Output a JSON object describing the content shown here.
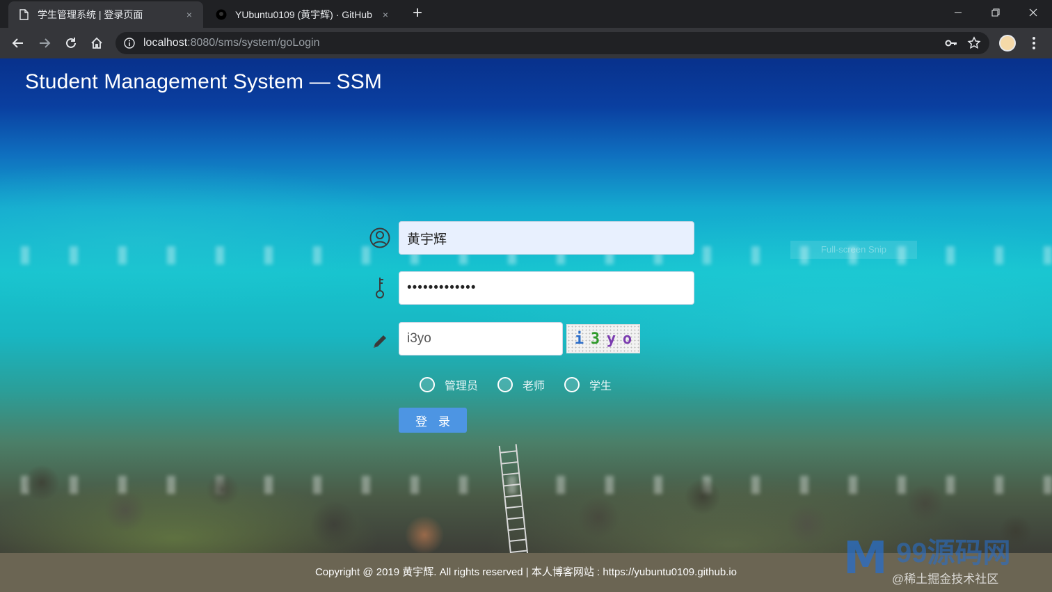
{
  "browser": {
    "tabs": [
      {
        "title": "学生管理系统 | 登录页面",
        "close": "×"
      },
      {
        "title": "YUbuntu0109 (黄宇辉) · GitHub",
        "close": "×"
      }
    ],
    "new_tab": "+",
    "url_host": "localhost",
    "url_path": ":8080/sms/system/goLogin"
  },
  "page": {
    "title": "Student Management System — SSM",
    "username_value": "黄宇辉",
    "password_value": "•••••••••••••",
    "captcha_input_value": "i3yo",
    "captcha_chars": [
      {
        "char": "i",
        "color": "#2a6cc9"
      },
      {
        "char": "3",
        "color": "#2f9a2a"
      },
      {
        "char": "y",
        "color": "#7a3bb0"
      },
      {
        "char": "o",
        "color": "#7a3bb0"
      }
    ],
    "roles": [
      "管理员",
      "老师",
      "学生"
    ],
    "login_label": "登录",
    "ghost_overlay": "Full-screen Snip",
    "footer_text": "Copyright @ 2019 黄宇辉. All rights reserved | 本人博客网站 : https://yubuntu0109.github.io"
  },
  "watermark": {
    "brand": "99源码网",
    "sub": "@稀土掘金技术社区"
  },
  "colors": {
    "login_button": "#4d95e3",
    "footer": "#6b6553",
    "ocean_top": "#08318c",
    "ocean_mid": "#17c4cf"
  }
}
